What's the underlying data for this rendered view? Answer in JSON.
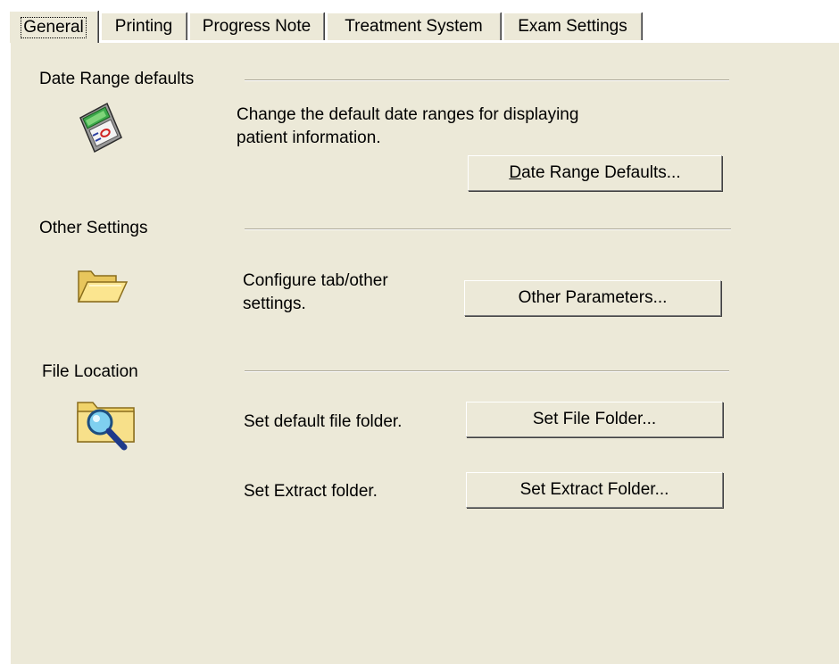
{
  "tabs": [
    {
      "label": "General",
      "active": true
    },
    {
      "label": "Printing",
      "active": false
    },
    {
      "label": "Progress Note",
      "active": false
    },
    {
      "label": "Treatment System",
      "active": false
    },
    {
      "label": "Exam Settings",
      "active": false
    }
  ],
  "sections": {
    "date_range": {
      "heading": "Date Range defaults",
      "description": "Change the default date ranges for displaying patient information.",
      "description_line1": "Change the default date ranges for displaying",
      "description_line2": "patient information.",
      "button_accel": "D",
      "button_rest": "ate Range Defaults...",
      "icon": "calculator-icon"
    },
    "other": {
      "heading": "Other Settings",
      "description_line1": "Configure tab/other",
      "description_line2": "settings.",
      "button_label": "Other Parameters...",
      "icon": "open-folder-icon"
    },
    "file_location": {
      "heading": "File Location",
      "icon": "folder-search-icon",
      "file_folder_text": "Set default file folder.",
      "file_folder_button": "Set File Folder...",
      "extract_text": "Set Extract folder.",
      "extract_button": "Set Extract Folder..."
    }
  },
  "colors": {
    "face": "#ECE9D8",
    "highlight": "#ffffff",
    "shadow": "#7f7f7f",
    "dark_shadow": "#404040"
  }
}
